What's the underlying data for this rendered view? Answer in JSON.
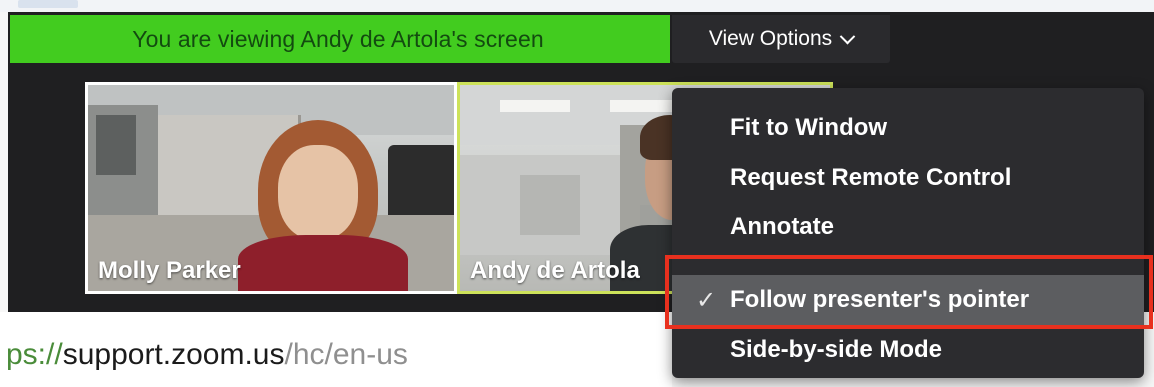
{
  "banner": {
    "text": "You are viewing Andy de Artola's screen",
    "color": "#42cc1f"
  },
  "view_options": {
    "label": "View Options",
    "icon": "chevron-down-icon"
  },
  "participants": [
    {
      "name": "Molly Parker"
    },
    {
      "name": "Andy de Artola"
    }
  ],
  "menu": {
    "items": [
      {
        "label": "Fit to Window",
        "checked": false
      },
      {
        "label": "Request Remote Control",
        "checked": false
      },
      {
        "label": "Annotate",
        "checked": false
      },
      {
        "label": "Follow presenter's pointer",
        "checked": true
      },
      {
        "label": "Side-by-side Mode",
        "checked": false
      }
    ],
    "check_glyph": "✓",
    "highlight_color": "#e8301e"
  },
  "url": {
    "scheme": "ps://",
    "host": "support.zoom.us",
    "path": "/hc/en-us"
  }
}
